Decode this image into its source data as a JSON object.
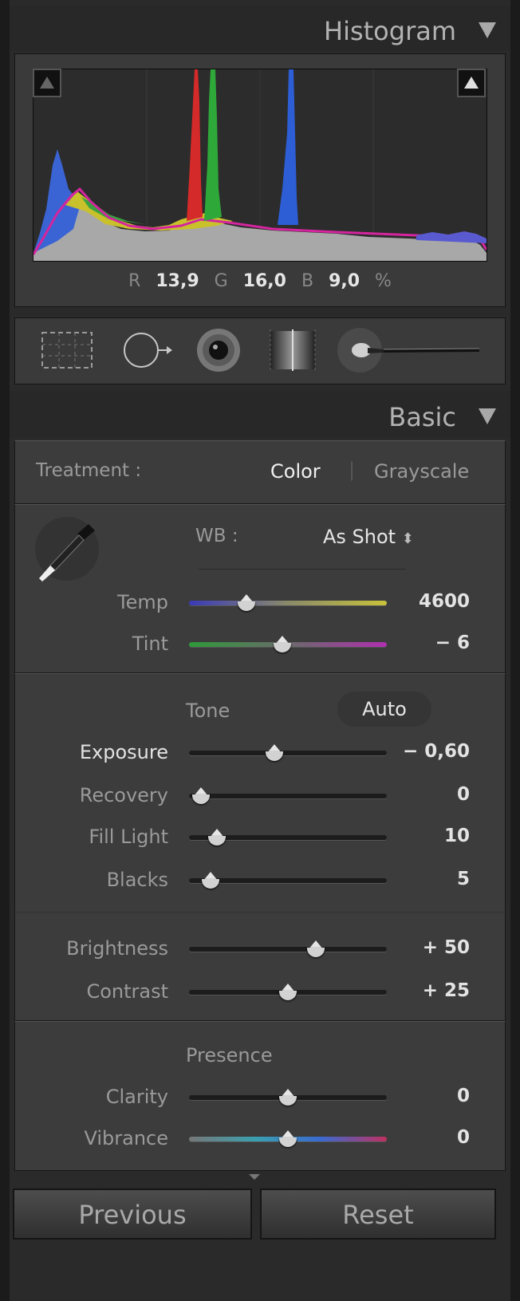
{
  "histogram": {
    "title": "Histogram",
    "readout": {
      "r_label": "R",
      "r_value": "13,9",
      "g_label": "G",
      "g_value": "16,0",
      "b_label": "B",
      "b_value": "9,0",
      "unit": "%"
    }
  },
  "toolstrip": {
    "tools": [
      "crop-overlay-icon",
      "spot-removal-icon",
      "red-eye-icon",
      "graduated-filter-icon",
      "adjustment-brush-icon"
    ]
  },
  "basic": {
    "title": "Basic",
    "treatment": {
      "label": "Treatment :",
      "color": "Color",
      "separator": "|",
      "grayscale": "Grayscale"
    },
    "wb": {
      "label": "WB :",
      "value": "As Shot",
      "arrows": "⬍"
    },
    "temp": {
      "label": "Temp",
      "value": "4600",
      "level": 0.29
    },
    "tint": {
      "label": "Tint",
      "value": "− 6",
      "level": 0.47
    },
    "tone": {
      "label": "Tone",
      "auto": "Auto"
    },
    "exposure": {
      "label": "Exposure",
      "value": "− 0,60",
      "level": 0.43
    },
    "recovery": {
      "label": "Recovery",
      "value": "0",
      "level": 0.06
    },
    "fill_light": {
      "label": "Fill Light",
      "value": "10",
      "level": 0.14
    },
    "blacks": {
      "label": "Blacks",
      "value": "5",
      "level": 0.11
    },
    "brightness": {
      "label": "Brightness",
      "value": "+ 50",
      "level": 0.64
    },
    "contrast": {
      "label": "Contrast",
      "value": "+ 25",
      "level": 0.5
    },
    "presence": {
      "label": "Presence"
    },
    "clarity": {
      "label": "Clarity",
      "value": "0",
      "level": 0.5
    },
    "vibrance": {
      "label": "Vibrance",
      "value": "0",
      "level": 0.5
    }
  },
  "buttons": {
    "previous": "Previous",
    "reset": "Reset"
  },
  "colors": {
    "accent": "#e3e3e3",
    "panel": "#3c3c3c",
    "red": "#d42a2a",
    "green": "#2fa83a",
    "blue": "#2d5ed6"
  }
}
